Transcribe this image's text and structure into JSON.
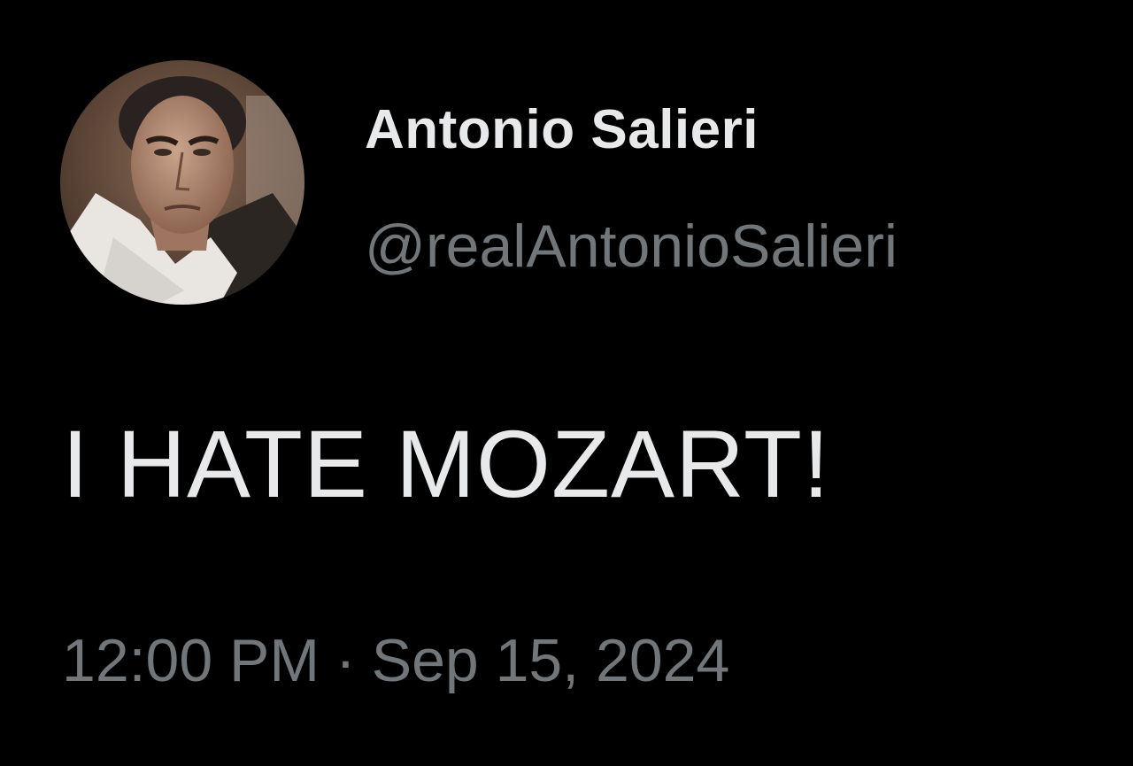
{
  "tweet": {
    "author": {
      "display_name": "Antonio Salieri",
      "handle": "@realAntonioSalieri",
      "avatar_icon": "profile-photo"
    },
    "text": "I HATE MOZART!",
    "time": "12:00 PM",
    "separator": "·",
    "date": "Sep 15, 2024"
  },
  "colors": {
    "background": "#000000",
    "primary_text": "#e7e9ea",
    "secondary_text": "#71767b"
  }
}
